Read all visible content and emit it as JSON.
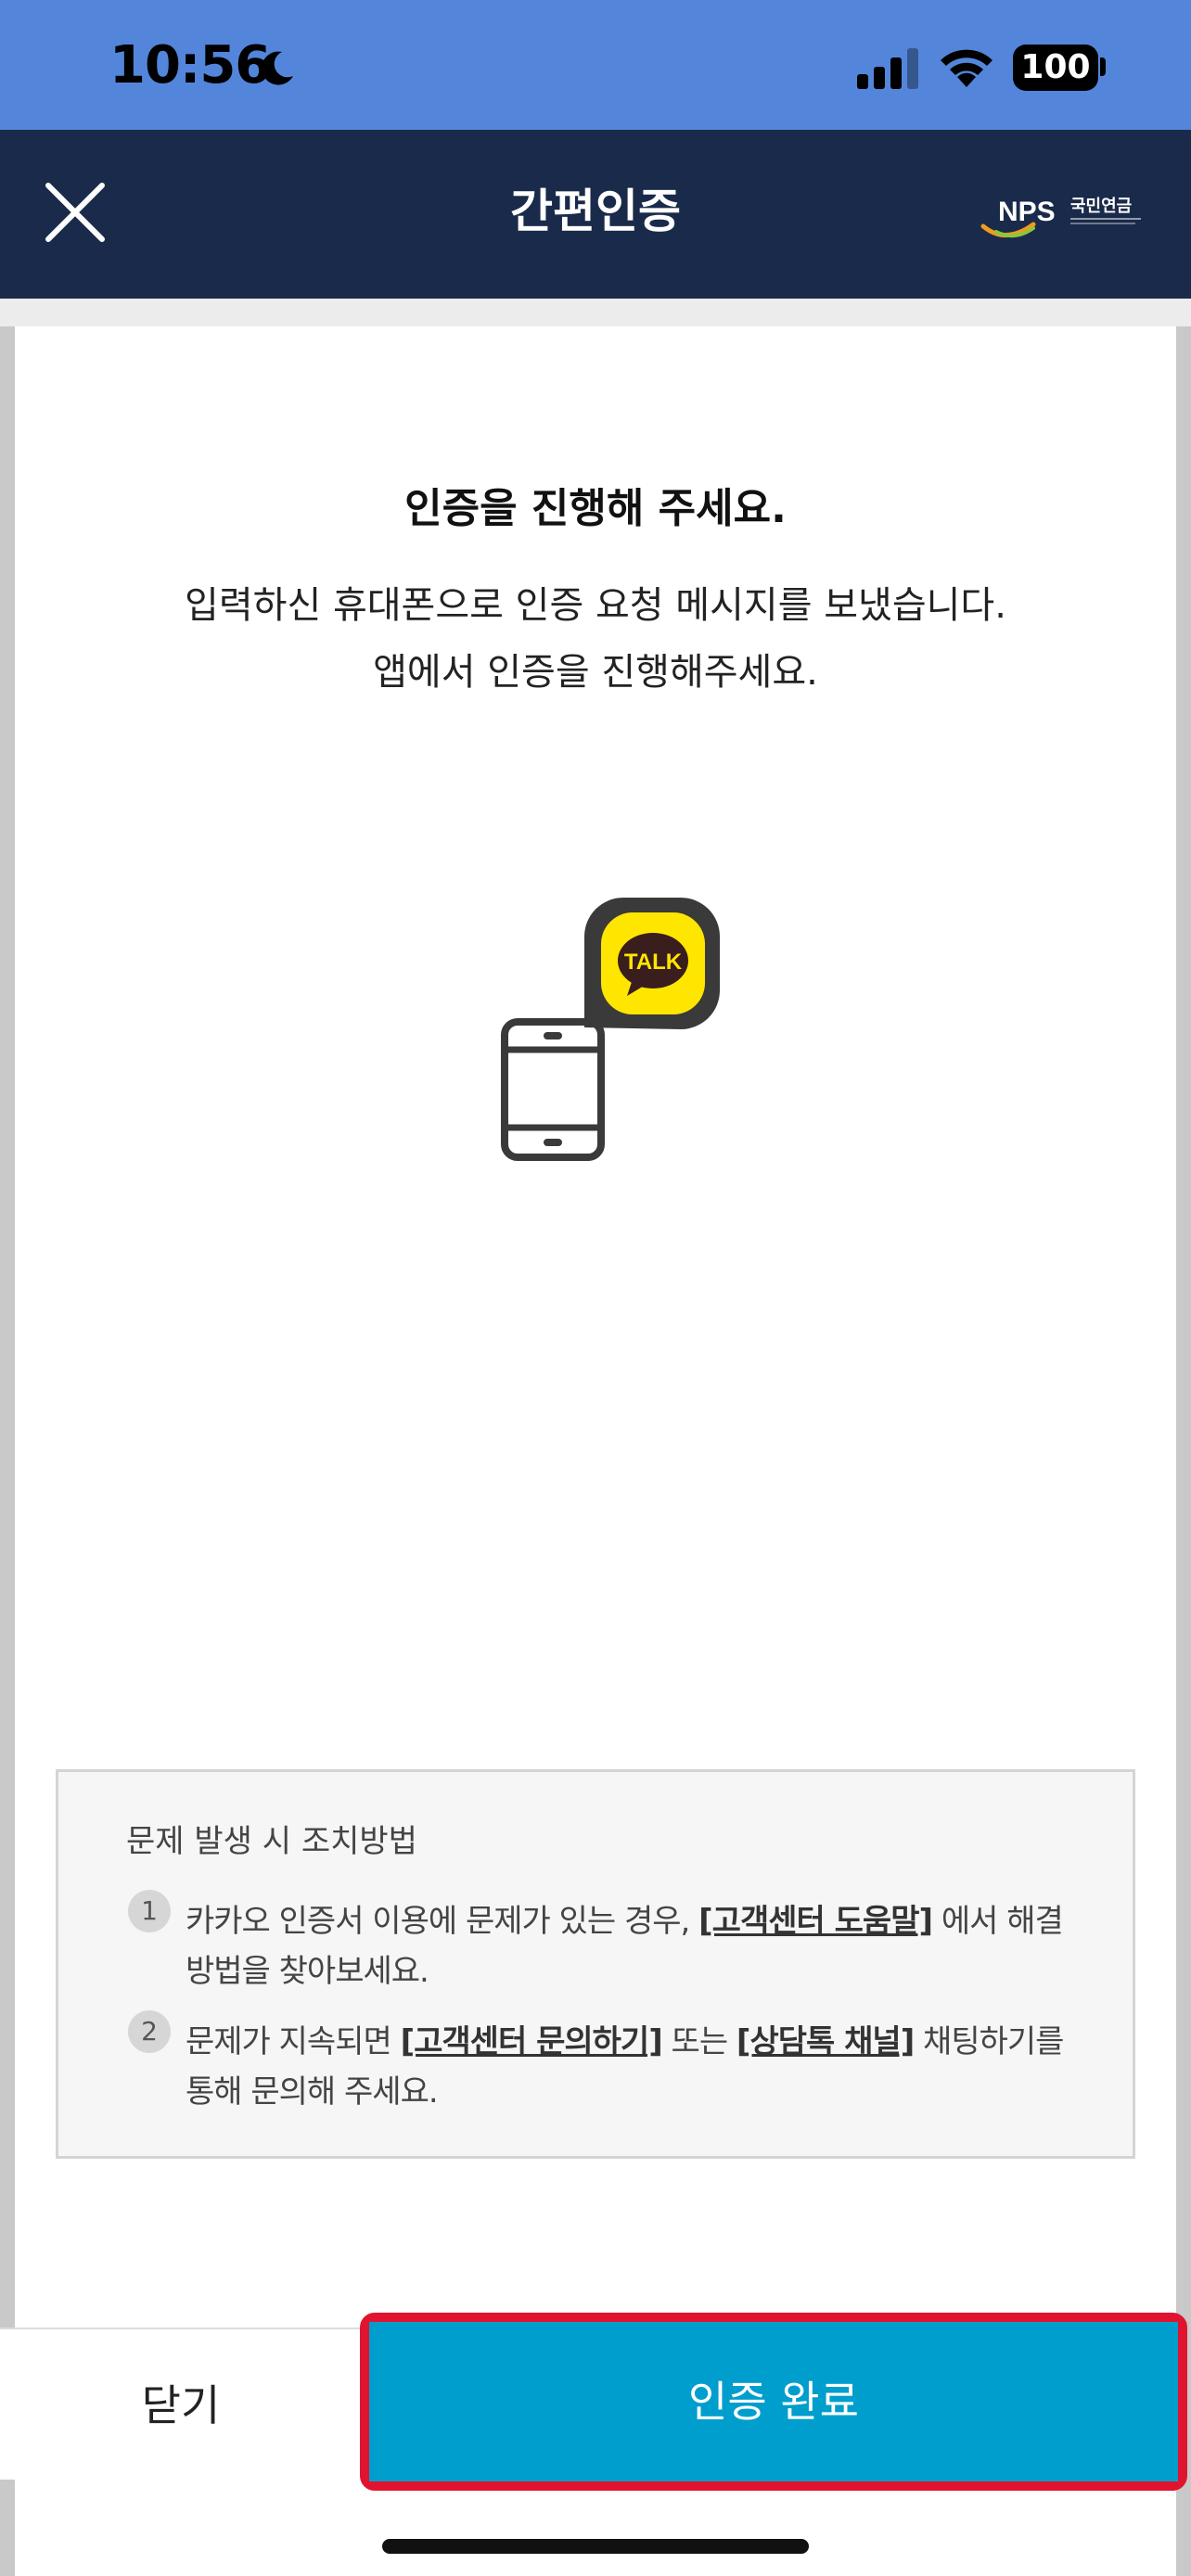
{
  "status_bar": {
    "time": "10:56",
    "battery": "100",
    "icons": [
      "moon-icon",
      "signal-icon",
      "wifi-icon",
      "battery-icon"
    ]
  },
  "header": {
    "title": "간편인증",
    "close_icon": "close-icon",
    "logo_text": "NPS",
    "logo_subtext": "국민연금"
  },
  "main": {
    "heading": "인증을 진행해 주세요.",
    "description_line1": "입력하신 휴대폰으로 인증 요청 메시지를 보냈습니다.",
    "description_line2": "앱에서 인증을 진행해주세요.",
    "illustration_badge": "TALK"
  },
  "help": {
    "title": "문제 발생 시 조치방법",
    "items": [
      {
        "number": "1",
        "text_before": "카카오 인증서 이용에 문제가 있는 경우, ",
        "link": "[고객센터 도움말]",
        "text_after": " 에서 해결",
        "line2": "방법을 찾아보세요."
      },
      {
        "number": "2",
        "text_before": "문제가 지속되면 ",
        "link": "[고객센터 문의하기]",
        "text_middle": " 또는 ",
        "link2": "[상담톡 채널]",
        "text_after": " 채팅하기를",
        "line2": "통해 문의해 주세요."
      }
    ]
  },
  "footer": {
    "close_label": "닫기",
    "confirm_label": "인증 완료"
  },
  "colors": {
    "status_bar": "#5386db",
    "app_bar": "#1a2a4a",
    "confirm_button": "#009ecd",
    "highlight_outline": "#e0142e",
    "kakao_yellow": "#ffe600"
  }
}
